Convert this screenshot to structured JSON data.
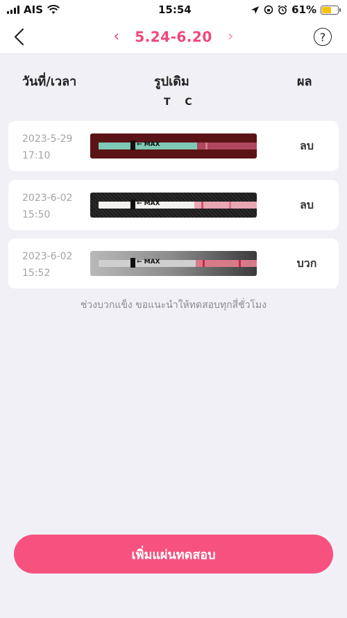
{
  "status_bar": {
    "carrier": "AIS",
    "time": "15:54",
    "battery_percent": "61%",
    "battery_level": 0.61
  },
  "nav": {
    "range": "5.24-6.20",
    "prev_icon": "‹",
    "next_icon": "›",
    "help_icon": "?"
  },
  "columns": {
    "date_time": "วันที่/เวลา",
    "original_image": "รูปเดิม",
    "tc": "T C",
    "result": "ผล"
  },
  "rows": [
    {
      "date": "2023-5-29",
      "time": "17:10",
      "result": "ลบ",
      "strip_label": "← MAX"
    },
    {
      "date": "2023-6-02",
      "time": "15:50",
      "result": "ลบ",
      "strip_label": "← MAX"
    },
    {
      "date": "2023-6-02",
      "time": "15:52",
      "result": "บวก",
      "strip_label": "← MAX"
    }
  ],
  "hint": "ช่วงบวกแข็ง ขอแนะนำให้ทดสอบทุกสี่ชั่วโมง",
  "add_button": "เพิ่มแผ่นทดสอบ",
  "colors": {
    "accent": "#f0477b",
    "button": "#f7527f",
    "background": "#f1f0f6"
  }
}
